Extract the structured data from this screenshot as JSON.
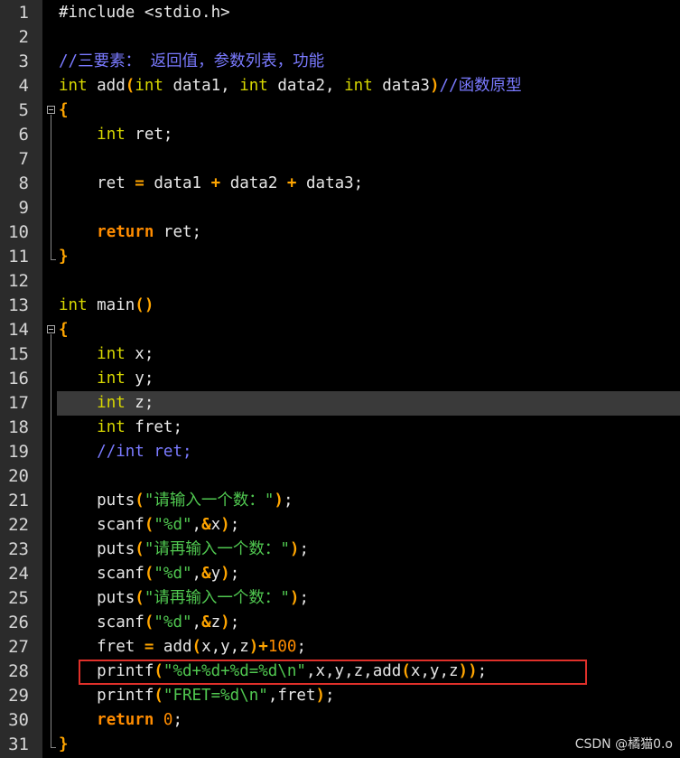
{
  "editor": {
    "watermark": "CSDN @橘猫0.o",
    "highlight_color": "#3a3a3a",
    "annotation_color": "#e0302a",
    "lines": [
      {
        "n": "1",
        "html": "#include &lt;stdio.h&gt;"
      },
      {
        "n": "2",
        "html": ""
      },
      {
        "n": "3",
        "html": "<span class='cm'>//三要素：&nbsp;返回值，参数列表，功能</span>"
      },
      {
        "n": "4",
        "html": "<span class='kw'>int</span> add<span class='op'>(</span><span class='kw'>int</span> data1, <span class='kw'>int</span> data2, <span class='kw'>int</span> data3<span class='op'>)</span><span class='cm'>//函数原型</span>"
      },
      {
        "n": "5",
        "html": "<span class='op'>{</span>"
      },
      {
        "n": "6",
        "html": "    <span class='kw'>int</span> ret;"
      },
      {
        "n": "7",
        "html": ""
      },
      {
        "n": "8",
        "html": "    ret <span class='op'>=</span> data1 <span class='op'>+</span> data2 <span class='op'>+</span> data3;"
      },
      {
        "n": "9",
        "html": ""
      },
      {
        "n": "10",
        "html": "    <span class='ret'>return</span> ret;"
      },
      {
        "n": "11",
        "html": "<span class='op'>}</span>"
      },
      {
        "n": "12",
        "html": ""
      },
      {
        "n": "13",
        "html": "<span class='kw'>int</span> main<span class='op'>()</span>"
      },
      {
        "n": "14",
        "html": "<span class='op'>{</span>"
      },
      {
        "n": "15",
        "html": "    <span class='kw'>int</span> x;"
      },
      {
        "n": "16",
        "html": "    <span class='kw'>int</span> y;"
      },
      {
        "n": "17",
        "html": "    <span class='kw'>int</span> z;"
      },
      {
        "n": "18",
        "html": "    <span class='kw'>int</span> fret;"
      },
      {
        "n": "19",
        "html": "    <span class='cm'>//int ret;</span>"
      },
      {
        "n": "20",
        "html": ""
      },
      {
        "n": "21",
        "html": "    puts<span class='op'>(</span><span class='str'>\"请输入一个数：\"</span><span class='op'>)</span>;"
      },
      {
        "n": "22",
        "html": "    scanf<span class='op'>(</span><span class='str'>\"%d\"</span>,<span class='op'>&amp;</span>x<span class='op'>)</span>;"
      },
      {
        "n": "23",
        "html": "    puts<span class='op'>(</span><span class='str'>\"请再输入一个数：\"</span><span class='op'>)</span>;"
      },
      {
        "n": "24",
        "html": "    scanf<span class='op'>(</span><span class='str'>\"%d\"</span>,<span class='op'>&amp;</span>y<span class='op'>)</span>;"
      },
      {
        "n": "25",
        "html": "    puts<span class='op'>(</span><span class='str'>\"请再输入一个数：\"</span><span class='op'>)</span>;"
      },
      {
        "n": "26",
        "html": "    scanf<span class='op'>(</span><span class='str'>\"%d\"</span>,<span class='op'>&amp;</span>z<span class='op'>)</span>;"
      },
      {
        "n": "27",
        "html": "    fret <span class='op'>=</span> add<span class='op'>(</span>x,y,z<span class='op'>)+</span><span class='num'>100</span>;"
      },
      {
        "n": "28",
        "html": "    printf<span class='op'>(</span><span class='str'>\"%d+%d+%d=%d\\n\"</span>,x,y,z,add<span class='op'>(</span>x,y,z<span class='op'>))</span>;"
      },
      {
        "n": "29",
        "html": "    printf<span class='op'>(</span><span class='str'>\"FRET=%d\\n\"</span>,fret<span class='op'>)</span>;"
      },
      {
        "n": "30",
        "html": "    <span class='ret'>return</span> <span class='num'>0</span>;"
      },
      {
        "n": "31",
        "html": "<span class='op'>}</span>"
      }
    ]
  }
}
